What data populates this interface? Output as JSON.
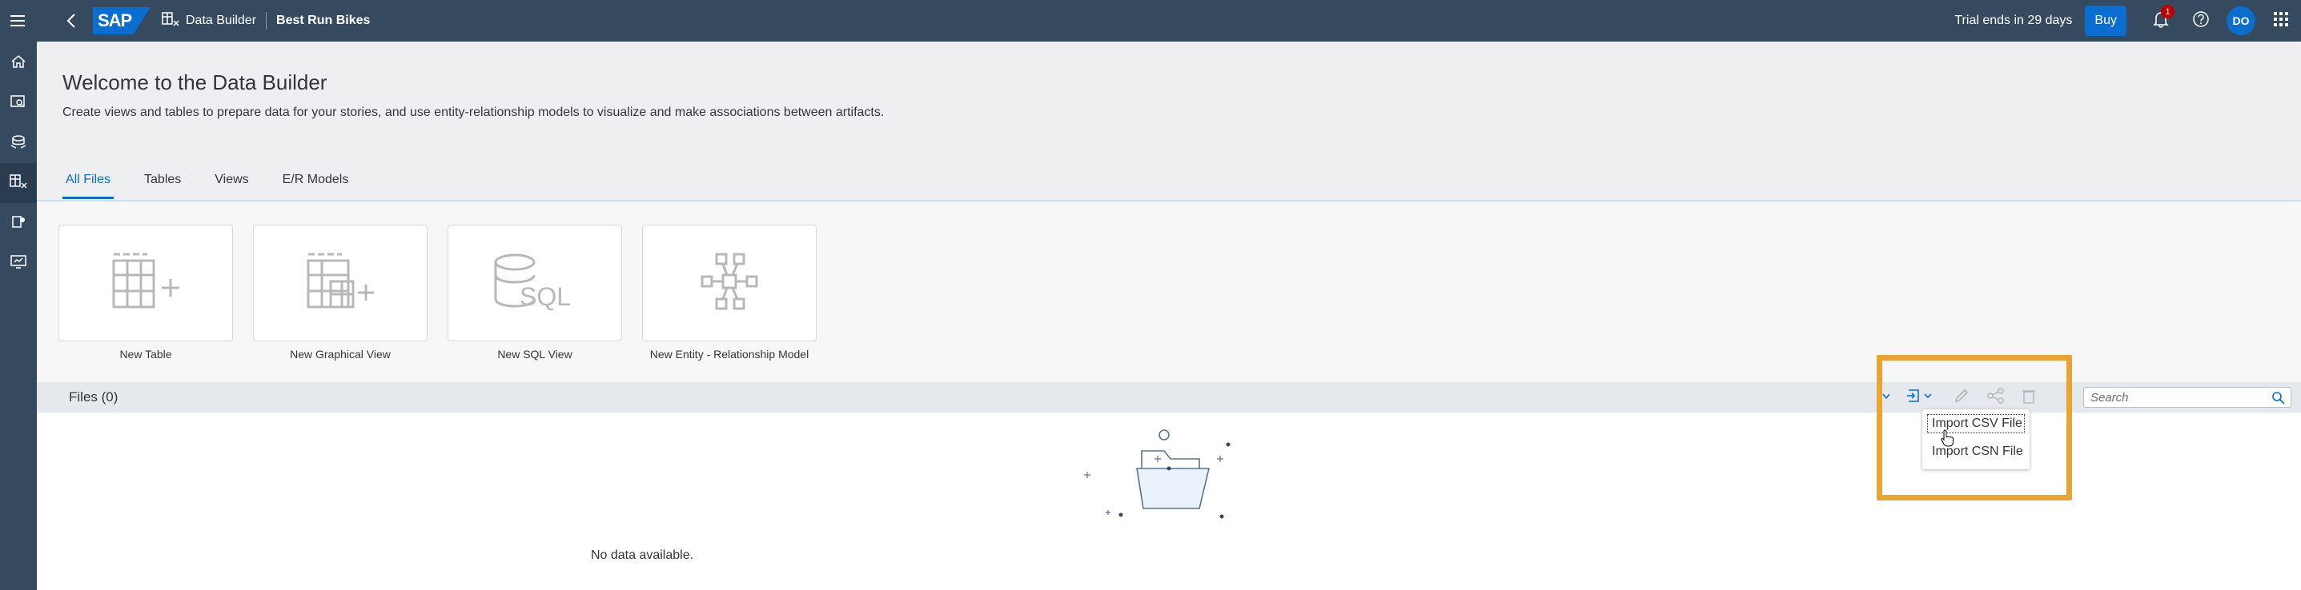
{
  "shell": {
    "logo": "SAP",
    "breadcrumb_app": "Data Builder",
    "breadcrumb_space": "Best Run Bikes",
    "trial_text": "Trial ends in 29 days",
    "buy_label": "Buy",
    "notification_count": "1",
    "avatar_initials": "DO"
  },
  "leftnav": {
    "items": [
      "home-icon",
      "data-search-icon",
      "data-flow-icon",
      "data-builder-icon",
      "security-icon",
      "monitor-icon"
    ],
    "active": "data-builder-icon"
  },
  "page": {
    "title": "Welcome to the Data Builder",
    "subtitle": "Create views and tables to prepare data for your stories, and use entity-relationship models to visualize and make associations between artifacts."
  },
  "tabs": [
    {
      "label": "All Files",
      "active": true
    },
    {
      "label": "Tables",
      "active": false
    },
    {
      "label": "Views",
      "active": false
    },
    {
      "label": "E/R Models",
      "active": false
    }
  ],
  "tiles": [
    {
      "label": "New Table",
      "icon": "new-table-icon"
    },
    {
      "label": "New Graphical View",
      "icon": "new-graphical-view-icon"
    },
    {
      "label": "New SQL View",
      "icon": "sql-icon"
    },
    {
      "label": "New Entity - Relationship Model",
      "icon": "er-model-icon"
    }
  ],
  "files": {
    "title": "Files (0)",
    "search_placeholder": "Search",
    "empty_text": "No data available."
  },
  "import_menu": {
    "items": [
      "Import CSV File",
      "Import CSN File"
    ]
  },
  "colors": {
    "shell": "#354a5f",
    "accent": "#0a6ed1",
    "highlight": "#e8a530"
  }
}
